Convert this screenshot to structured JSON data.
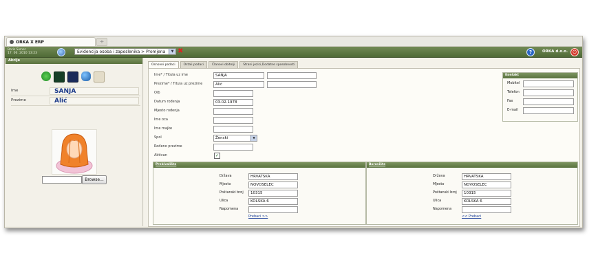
{
  "browser_tab": {
    "title": "ORKA X ERP",
    "new_tab": "+"
  },
  "topbar": {
    "user_name": "Boris Sisner",
    "datetime": "17. 06. 2010 13:23",
    "module": "Evidencija osoba i zaposlenika > Promjena",
    "company": "ORKA d.o.o."
  },
  "left_panel": {
    "header": "Akcije",
    "ime_label": "Ime",
    "ime_value": "SANJA",
    "prezime_label": "Prezime",
    "prezime_value": "Alić",
    "browse_label": "Browse..."
  },
  "tabs": [
    "Osnovni podaci",
    "Ostali podaci",
    "Članovi obitelji",
    "Strani jezici,Dodatne sposobnosti"
  ],
  "form": {
    "ime_label": "Ime* / Titula uz ime",
    "ime_value": "SANJA",
    "ime_titula": "",
    "prezime_label": "Prezime* / Titula uz prezime",
    "prezime_value": "Alić",
    "prezime_titula": "",
    "oib_label": "Oib",
    "oib_value": "",
    "datum_label": "Datum rođenja",
    "datum_value": "03.02.1978",
    "mjesto_rod_label": "Mjesto rođenja",
    "mjesto_rod_value": "",
    "ime_oca_label": "Ime oca",
    "ime_oca_value": "",
    "ime_majke_label": "Ime majke",
    "ime_majke_value": "",
    "spol_label": "Spol",
    "spol_value": "Ženski",
    "rodeno_prezime_label": "Rođeno prezime",
    "rodeno_prezime_value": "",
    "aktivan_label": "Aktivan",
    "aktivan_checked": true
  },
  "kontakt": {
    "header": "Kontakt",
    "mobitel_label": "Mobitel",
    "telefon_label": "Telefon",
    "fax_label": "Fax",
    "email_label": "E-mail"
  },
  "prebivaliste": {
    "header": "Prebivalište",
    "drzava_label": "Država",
    "drzava_value": "HRVATSKA",
    "mjesto_label": "Mjesto",
    "mjesto_value": "NOVOSELEC",
    "postanski_label": "Poštanski broj",
    "postanski_value": "10315",
    "ulica_label": "Ulica",
    "ulica_value": "KOLSKA 6",
    "napomena_label": "Napomena",
    "napomena_value": "",
    "link": "Prebaci >>"
  },
  "boraviste": {
    "header": "Boravište",
    "drzava_label": "Država",
    "drzava_value": "HRVATSKA",
    "mjesto_label": "Mjesto",
    "mjesto_value": "NOVOSELEC",
    "postanski_label": "Poštanski broj",
    "postanski_value": "10315",
    "ulica_label": "Ulica",
    "ulica_value": "KOLSKA 6",
    "napomena_label": "Napomena",
    "napomena_value": "",
    "link": "<< Prebaci"
  },
  "icons": {
    "refresh": "refresh-icon",
    "save": "save-icon",
    "save_as": "save-as-icon",
    "users": "users-icon",
    "id_card": "id-card-icon",
    "home": "home-icon",
    "help": "help-icon",
    "power": "power-icon",
    "close": "close-icon"
  },
  "colors": {
    "accent_green": "#5a733f",
    "link_blue": "#1b3e9a",
    "name_blue": "#1c3a8a",
    "close_red": "#d22222"
  }
}
